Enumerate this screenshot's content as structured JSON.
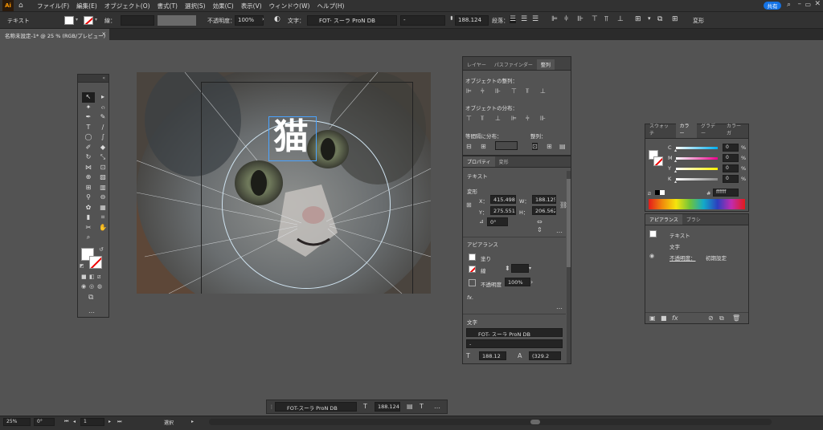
{
  "menubar": {
    "logo": "Ai",
    "items": [
      "ファイル(F)",
      "編集(E)",
      "オブジェクト(O)",
      "書式(T)",
      "選択(S)",
      "効果(C)",
      "表示(V)",
      "ウィンドウ(W)",
      "ヘルプ(H)"
    ],
    "share": "共有"
  },
  "control": {
    "type": "テキスト",
    "stroke_label": "線：",
    "opacity_label": "不透明度：",
    "opacity": "100%",
    "char_label": "文字：",
    "font": "FOT- スーラ ProN DB",
    "style": "-",
    "size": "188.124",
    "para_label": "段落：",
    "transform": "変形"
  },
  "doc": {
    "tab": "名称未設定-1* @ 25 % (RGB/プレビュー)",
    "close": "×"
  },
  "artwork": {
    "text": "猫"
  },
  "align": {
    "tabs": [
      "レイヤー",
      "パスファインダー",
      "整列"
    ],
    "h1": "オブジェクトの整列：",
    "h2": "オブジェクトの分布：",
    "h3": "等間隔に分布：",
    "h4": "整列："
  },
  "props": {
    "tabs": [
      "プロパティ",
      "変形"
    ],
    "type": "テキスト",
    "transform": "変形",
    "x": "415.498",
    "y": "275.551",
    "w": "188.125",
    "h": "206.562",
    "angle": "0°",
    "appearance": "アピアランス",
    "fill": "塗り",
    "stroke": "線",
    "opacity_label": "不透明度",
    "opacity": "100%",
    "fx": "fx.",
    "char": "文字",
    "font": "FOT- スーラ ProN DB",
    "style": "-",
    "size": "188.12",
    "tracking": "(329.2"
  },
  "color": {
    "tabs": [
      "スウォッチ",
      "カラー",
      "グラデー",
      "カラーガ"
    ],
    "channels": [
      {
        "n": "C",
        "v": "0",
        "u": "%",
        "c": "#00aeef"
      },
      {
        "n": "M",
        "v": "0",
        "u": "%",
        "c": "#ec008c"
      },
      {
        "n": "Y",
        "v": "0",
        "u": "%",
        "c": "#fff200"
      },
      {
        "n": "K",
        "v": "0",
        "u": "%",
        "c": "#888888"
      }
    ],
    "hex_mark": "#",
    "hex": "ffffff"
  },
  "appearance": {
    "tabs": [
      "アピアランス",
      "ブラシ"
    ],
    "title": "テキスト",
    "char": "文字",
    "opacity_label": "不透明度：",
    "opacity_val": "初期設定"
  },
  "bottom": {
    "font": "FOT-スーラ ProN DB",
    "size": "188.124"
  },
  "status": {
    "zoom": "25%",
    "angle": "0°",
    "page": "1",
    "mode": "選択"
  }
}
